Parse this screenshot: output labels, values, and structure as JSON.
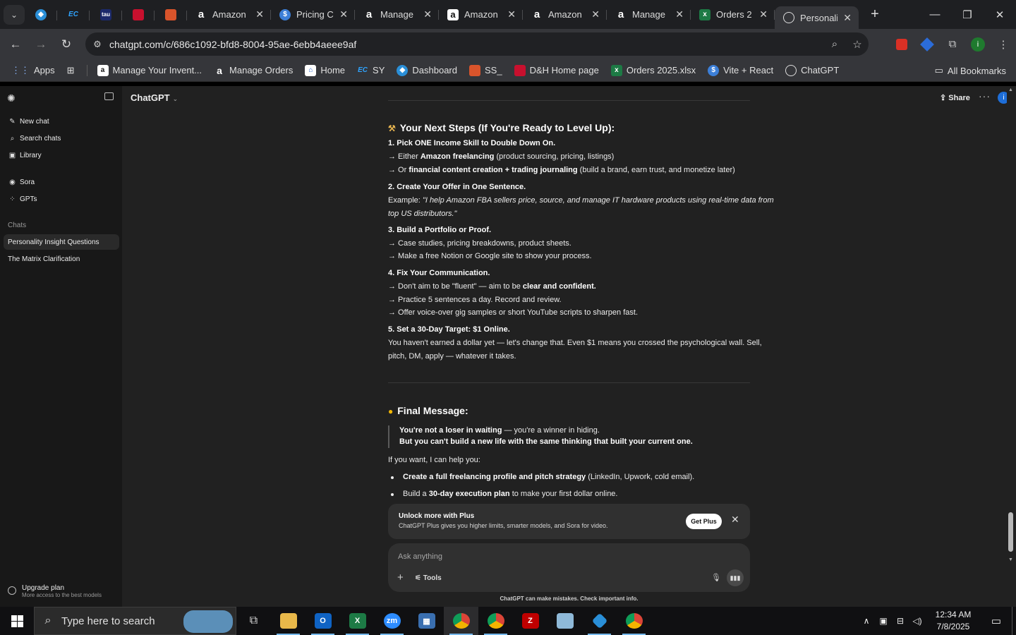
{
  "browser": {
    "tabs": [
      {
        "label": "Amazon",
        "icon": "amazon-icon"
      },
      {
        "label": "Pricing C",
        "icon": "dollar-icon"
      },
      {
        "label": "Manage",
        "icon": "amazon-icon"
      },
      {
        "label": "Amazon",
        "icon": "amazon-icon"
      },
      {
        "label": "Amazon",
        "icon": "amazon-icon"
      },
      {
        "label": "Manage",
        "icon": "amazon-icon"
      },
      {
        "label": "Orders 2",
        "icon": "excel-icon"
      },
      {
        "label": "Personali",
        "icon": "chatgpt-icon"
      }
    ],
    "pinned_tab_texts": [
      "EC",
      "tau"
    ],
    "url": "chatgpt.com/c/686c1092-bfd8-8004-95ae-6ebb4aeee9af",
    "profile_initial": "i",
    "bookmarks": [
      {
        "label": "Apps"
      },
      {
        "label": "Manage Your Invent..."
      },
      {
        "label": "Manage Orders"
      },
      {
        "label": "Home"
      },
      {
        "label": "SY"
      },
      {
        "label": "Dashboard"
      },
      {
        "label": "SS_"
      },
      {
        "label": "D&H Home page"
      },
      {
        "label": "Orders 2025.xlsx"
      },
      {
        "label": "Vite + React"
      },
      {
        "label": "ChatGPT"
      }
    ],
    "all_bookmarks": "All Bookmarks"
  },
  "sidebar": {
    "nav": [
      {
        "label": "New chat",
        "icon": "compose-icon"
      },
      {
        "label": "Search chats",
        "icon": "search-icon"
      },
      {
        "label": "Library",
        "icon": "library-icon"
      },
      {
        "label": "Sora",
        "icon": "sora-icon"
      },
      {
        "label": "GPTs",
        "icon": "gpts-icon"
      }
    ],
    "chats_heading": "Chats",
    "chats": [
      "Personality Insight Questions",
      "The Matrix Clarification"
    ],
    "upgrade_title": "Upgrade plan",
    "upgrade_sub": "More access to the best models"
  },
  "header": {
    "model": "ChatGPT",
    "share": "Share",
    "avatar": "i"
  },
  "message": {
    "next_steps_heading": "Your Next Steps (If You're Ready to Level Up):",
    "step1_title": "1. Pick ONE Income Skill to Double Down On.",
    "step1_a_pre": "→ Either ",
    "step1_a_bold": "Amazon freelancing",
    "step1_a_post": " (product sourcing, pricing, listings)",
    "step1_b_pre": "→ Or ",
    "step1_b_bold": "financial content creation + trading journaling",
    "step1_b_post": " (build a brand, earn trust, and monetize later)",
    "step2_title": "2. Create Your Offer in One Sentence.",
    "step2_ex_label": "Example: ",
    "step2_ex_line1": "\"I help Amazon FBA sellers price, source, and manage IT hardware products using real-time data from",
    "step2_ex_line2": "top US distributors.\"",
    "step3_title": "3. Build a Portfolio or Proof.",
    "step3_a": "→ Case studies, pricing breakdowns, product sheets.",
    "step3_b": "→ Make a free Notion or Google site to show your process.",
    "step4_title": "4. Fix Your Communication.",
    "step4_a_pre": "→ Don't aim to be \"fluent\" — aim to be ",
    "step4_a_bold": "clear and confident.",
    "step4_b": "→ Practice 5 sentences a day. Record and review.",
    "step4_c": "→ Offer voice-over gig samples or short YouTube scripts to sharpen fast.",
    "step5_title": "5. Set a 30-Day Target: $1 Online.",
    "step5_line1": "You haven't earned a dollar yet — let's change that. Even $1 means you crossed the psychological wall. Sell,",
    "step5_line2": "pitch, DM, apply — whatever it takes.",
    "final_heading": "Final Message:",
    "quote1_bold": "You're not a loser in waiting",
    "quote1_post": " — you're a winner in hiding.",
    "quote2": "But you can't build a new life with the same thinking that built your current one.",
    "help_intro": "If you want, I can help you:",
    "bullet1_bold": "Create a full freelancing profile and pitch strategy",
    "bullet1_post": " (LinkedIn, Upwork, cold email).",
    "bullet2_pre": "Build a ",
    "bullet2_bold": "30-day execution plan",
    "bullet2_post": " to make your first dollar online."
  },
  "plus_banner": {
    "title": "Unlock more with Plus",
    "subtitle": "ChatGPT Plus gives you higher limits, smarter models, and Sora for video.",
    "button": "Get Plus"
  },
  "composer": {
    "placeholder": "Ask anything",
    "tools": "Tools",
    "disclaimer": "ChatGPT can make mistakes. Check important info."
  },
  "taskbar": {
    "search_placeholder": "Type here to search",
    "time": "12:34 AM",
    "date": "7/8/2025"
  }
}
